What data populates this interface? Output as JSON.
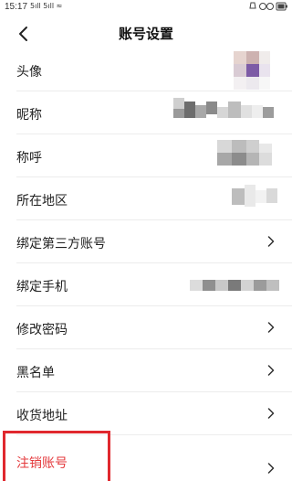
{
  "status_bar": {
    "time": "15:17",
    "signal": "5ıll 5ıll ≈"
  },
  "nav": {
    "title": "账号设置"
  },
  "rows": [
    {
      "label": "头像"
    },
    {
      "label": "昵称"
    },
    {
      "label": "称呼"
    },
    {
      "label": "所在地区"
    },
    {
      "label": "绑定第三方账号"
    },
    {
      "label": "绑定手机"
    },
    {
      "label": "修改密码"
    },
    {
      "label": "黑名单"
    },
    {
      "label": "收货地址"
    },
    {
      "label": "注销账号"
    }
  ],
  "sub_text": "",
  "colors": {
    "danger": "#e4393c",
    "highlight_box": "#e0282e",
    "avatar_purple": "#7d5ba6",
    "avatar_pink": "#cdb2b0"
  }
}
